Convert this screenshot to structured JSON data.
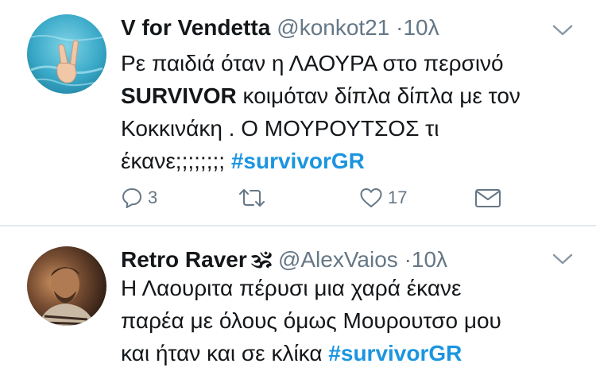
{
  "tweets": [
    {
      "display_name": "V for Vendetta",
      "handle": "@konkot21",
      "separator": "·",
      "time": "10λ",
      "body": {
        "line1": "Ρε παιδιά όταν η ΛΑΟΥΡΑ στο περσινό",
        "line2_bold": "SURVIVOR",
        "line2_rest": " κοιμόταν δίπλα δίπλα με τον",
        "line3": "Κοκκινάκη . Ο ΜΟΥΡΟΥΤΣΟΣ τι",
        "line4": "έκανε;;;;;;;; ",
        "hashtag": "#survivorGR"
      },
      "actions": {
        "reply_count": "3",
        "retweet_count": "",
        "like_count": "17"
      },
      "avatar_icon": "peace-hand-pool-avatar"
    },
    {
      "display_name": "Retro Raver",
      "emoji": "🕉",
      "handle": "@AlexVaios",
      "separator": "·",
      "time": "10λ",
      "body": {
        "line1": "Η Λαουριτα πέρυσι μια χαρά έκανε",
        "line2": "παρέα με όλους όμως Μουρουτσο μου",
        "line3": "και ήταν και σε κλίκα ",
        "hashtag": "#survivorGR"
      },
      "avatar_icon": "man-portrait-avatar"
    }
  ],
  "colors": {
    "text": "#14171a",
    "secondary": "#657786",
    "hashtag": "#1b95e0",
    "divider": "#e1e8ed"
  }
}
